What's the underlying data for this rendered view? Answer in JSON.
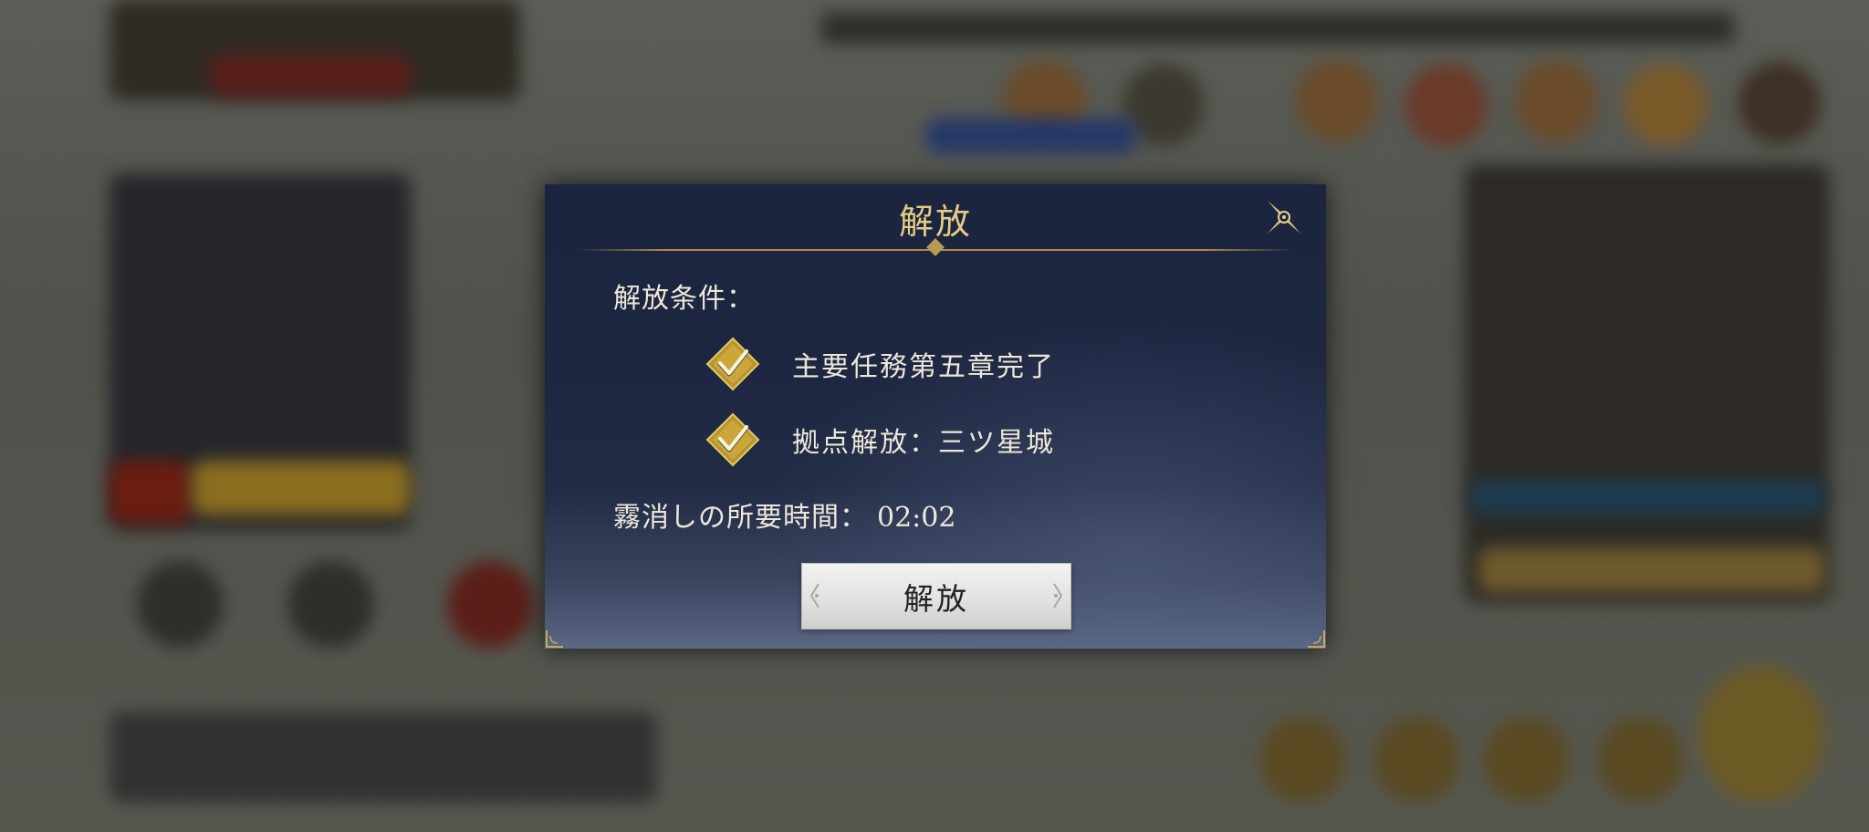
{
  "modal": {
    "title": "解放",
    "conditions_label": "解放条件：",
    "conditions": [
      {
        "text": "主要任務第五章完了",
        "completed": true
      },
      {
        "text": "拠点解放：三ツ星城",
        "completed": true
      }
    ],
    "time_label": "霧消しの所要時間：",
    "time_value": "02:02",
    "release_button": "解放",
    "close_icon": "close-x-icon"
  },
  "colors": {
    "title_gold": "#e4cc84",
    "check_gold": "#c9a73a",
    "text": "#ece7d8",
    "panel": "#1d2641"
  }
}
